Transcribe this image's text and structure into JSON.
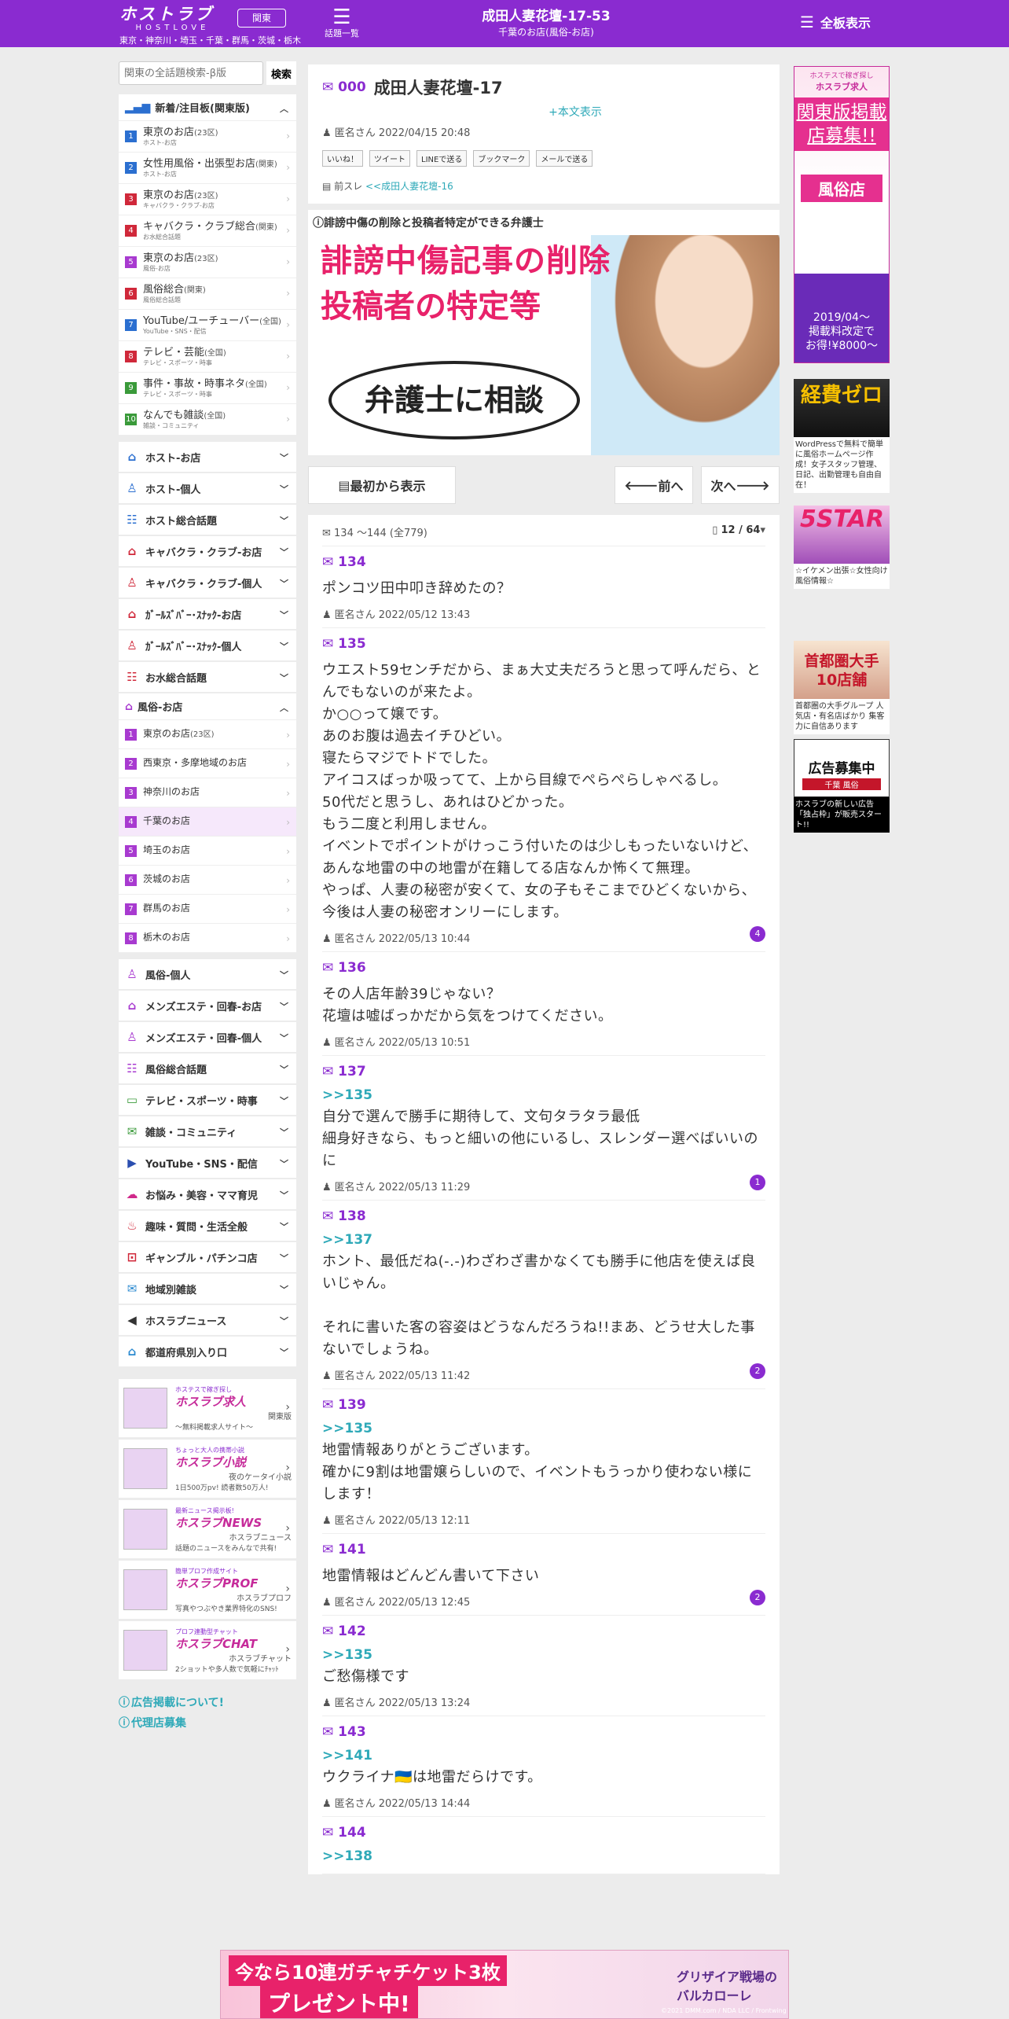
{
  "header": {
    "logo_main": "ホストラブ",
    "logo_sub": "HOSTLOVE",
    "region_button": "関東",
    "areas": "東京・神奈川・埼玉・千葉・群馬・茨城・栃木",
    "topics_label": "話題一覧",
    "title": "成田人妻花壇-17-53",
    "subtitle": "千葉のお店(風俗-お店)",
    "allboards": "全板表示"
  },
  "sidebar": {
    "search_placeholder": "関東の全話題検索-β版",
    "search_button": "検索",
    "featured_header": "新着/注目板(関東版)",
    "featured": [
      {
        "num": "1",
        "label": "東京のお店",
        "count": "(23区)",
        "sub": "ホスト-お店",
        "color": "#2b6fd0"
      },
      {
        "num": "2",
        "label": "女性用風俗・出張型お店",
        "count": "(関東)",
        "sub": "ホスト-お店",
        "color": "#2b6fd0"
      },
      {
        "num": "3",
        "label": "東京のお店",
        "count": "(23区)",
        "sub": "キャバクラ・クラブ-お店",
        "color": "#d0283a"
      },
      {
        "num": "4",
        "label": "キャバクラ・クラブ総合",
        "count": "(関東)",
        "sub": "お水総合話題",
        "color": "#d0283a"
      },
      {
        "num": "5",
        "label": "東京のお店",
        "count": "(23区)",
        "sub": "風俗-お店",
        "color": "#a83ad0"
      },
      {
        "num": "6",
        "label": "風俗総合",
        "count": "(関東)",
        "sub": "風俗総合話題",
        "color": "#d0283a"
      },
      {
        "num": "7",
        "label": "YouTube/ユーチューバー",
        "count": "(全国)",
        "sub": "YouTube・SNS・配信",
        "color": "#2b6fd0"
      },
      {
        "num": "8",
        "label": "テレビ・芸能",
        "count": "(全国)",
        "sub": "テレビ・スポーツ・時事",
        "color": "#d0283a"
      },
      {
        "num": "9",
        "label": "事件・事故・時事ネタ",
        "count": "(全国)",
        "sub": "テレビ・スポーツ・時事",
        "color": "#3a9a3a"
      },
      {
        "num": "10",
        "label": "なんでも雑談",
        "count": "(全国)",
        "sub": "雑談・コミュニティ",
        "color": "#3a9a3a"
      }
    ],
    "categories_a": [
      {
        "icon": "⌂",
        "label": "ホスト-お店",
        "color": "#2b6fd0"
      },
      {
        "icon": "♙",
        "label": "ホスト-個人",
        "color": "#2b6fd0"
      },
      {
        "icon": "☷",
        "label": "ホスト総合話題",
        "color": "#2b6fd0"
      },
      {
        "icon": "⌂",
        "label": "キャバクラ・クラブ-お店",
        "color": "#d0283a"
      },
      {
        "icon": "♙",
        "label": "キャバクラ・クラブ-個人",
        "color": "#d0283a"
      },
      {
        "icon": "⌂",
        "label": "ｶﾞｰﾙｽﾞﾊﾞｰ･ｽﾅｯｸ-お店",
        "color": "#d0283a"
      },
      {
        "icon": "♙",
        "label": "ｶﾞｰﾙｽﾞﾊﾞｰ･ｽﾅｯｸ-個人",
        "color": "#d0283a"
      },
      {
        "icon": "☷",
        "label": "お水総合話題",
        "color": "#d0283a"
      }
    ],
    "fuzoku_header": "風俗-お店",
    "fuzoku": [
      {
        "num": "1",
        "label": "東京のお店",
        "count": "(23区)"
      },
      {
        "num": "2",
        "label": "西東京・多摩地域のお店",
        "count": ""
      },
      {
        "num": "3",
        "label": "神奈川のお店",
        "count": ""
      },
      {
        "num": "4",
        "label": "千葉のお店",
        "count": ""
      },
      {
        "num": "5",
        "label": "埼玉のお店",
        "count": ""
      },
      {
        "num": "6",
        "label": "茨城のお店",
        "count": ""
      },
      {
        "num": "7",
        "label": "群馬のお店",
        "count": ""
      },
      {
        "num": "8",
        "label": "栃木のお店",
        "count": ""
      }
    ],
    "categories_b": [
      {
        "icon": "♙",
        "label": "風俗-個人",
        "color": "#a83ad0"
      },
      {
        "icon": "⌂",
        "label": "メンズエステ・回春-お店",
        "color": "#a83ad0"
      },
      {
        "icon": "♙",
        "label": "メンズエステ・回春-個人",
        "color": "#a83ad0"
      },
      {
        "icon": "☷",
        "label": "風俗総合話題",
        "color": "#a83ad0"
      },
      {
        "icon": "▭",
        "label": "テレビ・スポーツ・時事",
        "color": "#3a9a3a"
      },
      {
        "icon": "✉",
        "label": "雑談・コミュニティ",
        "color": "#3a9a3a"
      },
      {
        "icon": "▶",
        "label": "YouTube・SNS・配信",
        "color": "#2b4fb0"
      },
      {
        "icon": "☁",
        "label": "お悩み・美容・ママ育児",
        "color": "#d0288a"
      },
      {
        "icon": "♨",
        "label": "趣味・質問・生活全般",
        "color": "#d0283a"
      },
      {
        "icon": "⊡",
        "label": "ギャンブル・パチンコ店",
        "color": "#d0283a"
      },
      {
        "icon": "✉",
        "label": "地域別雑談",
        "color": "#2b8ad0"
      },
      {
        "icon": "◀",
        "label": "ホスラブニュース",
        "color": "#333333"
      },
      {
        "icon": "⌂",
        "label": "都道府県別入り口",
        "color": "#2b8ad0"
      }
    ],
    "promos": [
      {
        "top": "ホステスで稼ぎ探し",
        "name": "ホスラブ求人",
        "sub": "関東版",
        "desc": "〜無料掲載求人サイト〜"
      },
      {
        "top": "ちょっと大人の携帯小説",
        "name": "ホスラブ小説",
        "sub": "夜のケータイ小説",
        "desc": "1日500万pv! 読者数50万人!"
      },
      {
        "top": "最新ニュース掲示板!",
        "name": "ホスラブNEWS",
        "sub": "ホスラブニュース",
        "desc": "話題のニュースをみんなで共有!"
      },
      {
        "top": "簡単プロフ作成サイト",
        "name": "ホスラブPROF",
        "sub": "ホスラブプロフ",
        "desc": "写真やつぶやき業界特化のSNS!"
      },
      {
        "top": "プロフ連動型チャット",
        "name": "ホスラブCHAT",
        "sub": "ホスラブチャット",
        "desc": "2ショットや多人数で気軽にﾁｬｯﾄ"
      }
    ],
    "info_links": [
      "広告掲載について!",
      "代理店募集"
    ]
  },
  "thread": {
    "no": "000",
    "title": "成田人妻花壇-17",
    "show_body": "+本文表示",
    "meta": "匿名さん 2022/04/15 20:48",
    "share": [
      "いいね！",
      "ツイート",
      "LINEで送る",
      "ブックマーク",
      "メールで送る"
    ],
    "prev_label": "前スレ",
    "prev_link": "<<成田人妻花壇-16"
  },
  "ad_banner": {
    "label": "誹謗中傷の削除と投稿者特定ができる弁護士",
    "line1": "誹謗中傷記事の削除",
    "line2": "投稿者の特定等",
    "bubble": "弁護士に相談"
  },
  "nav": {
    "first": "最初から表示",
    "prev": "前へ",
    "next": "次へ"
  },
  "posts_header": {
    "range": "134 ～144 (全779)",
    "page": "12 / 64"
  },
  "posts": [
    {
      "no": "134",
      "anchor": "",
      "body": "ポンコツ田中叩き辞めたの？",
      "meta": "匿名さん 2022/05/12 13:43",
      "replies": ""
    },
    {
      "no": "135",
      "anchor": "",
      "body": "ウエスト59センチだから、まぁ大丈夫だろうと思って呼んだら、とんでもないのが来たよ。\nか○○って嬢です。\nあのお腹は過去イチひどい。\n寝たらマジでトドでした。\nアイコスばっか吸ってて、上から目線でぺらぺらしゃべるし。\n50代だと思うし、あれはひどかった。\nもう二度と利用しません。\nイベントでポイントがけっこう付いたのは少しもったいないけど、あんな地雷の中の地雷が在籍してる店なんか怖くて無理。\nやっぱ、人妻の秘密が安くて、女の子もそこまでひどくないから、今後は人妻の秘密オンリーにします。",
      "meta": "匿名さん 2022/05/13 10:44",
      "replies": "4"
    },
    {
      "no": "136",
      "anchor": "",
      "body": "その人店年齢39じゃない？\n花壇は嘘ばっかだから気をつけてください。",
      "meta": "匿名さん 2022/05/13 10:51",
      "replies": ""
    },
    {
      "no": "137",
      "anchor": ">>135",
      "body": "自分で選んで勝手に期待して、文句タラタラ最低\n細身好きなら、もっと細いの他にいるし、スレンダー選べばいいのに",
      "meta": "匿名さん 2022/05/13 11:29",
      "replies": "1"
    },
    {
      "no": "138",
      "anchor": ">>137",
      "body": "ホント、最低だね(-.-)わざわざ書かなくても勝手に他店を使えば良いじゃん。\n\nそれに書いた客の容姿はどうなんだろうね!!まあ、どうせ大した事ないでしょうね。",
      "meta": "匿名さん 2022/05/13 11:42",
      "replies": "2"
    },
    {
      "no": "139",
      "anchor": ">>135",
      "body": "地雷情報ありがとうございます。\n確かに9割は地雷嬢らしいので、イベントもうっかり使わない様にします！",
      "meta": "匿名さん 2022/05/13 12:11",
      "replies": ""
    },
    {
      "no": "141",
      "anchor": "",
      "body": "地雷情報はどんどん書いて下さい",
      "meta": "匿名さん 2022/05/13 12:45",
      "replies": "2"
    },
    {
      "no": "142",
      "anchor": ">>135",
      "body": "ご愁傷様です",
      "meta": "匿名さん 2022/05/13 13:24",
      "replies": ""
    },
    {
      "no": "143",
      "anchor": ">>141",
      "body": "ウクライナ🇺🇦は地雷だらけです。",
      "meta": "匿名さん 2022/05/13 14:44",
      "replies": ""
    },
    {
      "no": "144",
      "anchor": ">>138",
      "body": "",
      "meta": "",
      "replies": ""
    }
  ],
  "right_ads": {
    "ad1": {
      "t1": "ホステスで稼ぎ探し",
      "t2": "ホスラブ求人",
      "t3": "関東版掲載店募集!!",
      "t4": "風俗店",
      "t5": "2019/04〜\n掲載料改定で\nお得!¥8000〜"
    },
    "ad2": {
      "z": "経費ゼロ",
      "cap": "WordPressで無料で簡単に風俗ホームページ作成！女子スタッフ管理、日記、出勤管理も自由自在！"
    },
    "ad3": {
      "s": "5STAR",
      "cap": "☆イケメン出張☆女性向け風俗情報☆"
    },
    "ad4": {
      "s": "首都圏大手\n10店舗",
      "cap": "首都圏の大手グループ 人気店・有名店ばかり 集客力に自信あります"
    },
    "ad5": {
      "s": "広告募集中",
      "r": "千葉 風俗",
      "cap": "ホスラブの新しい広告「独占枠」が販売スタート!!"
    }
  },
  "bottom_ad": {
    "l1": "今なら10連ガチャチケット3枚",
    "l2": "プレゼント中!",
    "l3": "グリザイア戦場のバルカローレ",
    "l4": "©2021 DMM.com / NDA LLC / Frontwing"
  },
  "colors": {
    "brand": "#8a2bd0",
    "accent": "#2ea9b8"
  }
}
